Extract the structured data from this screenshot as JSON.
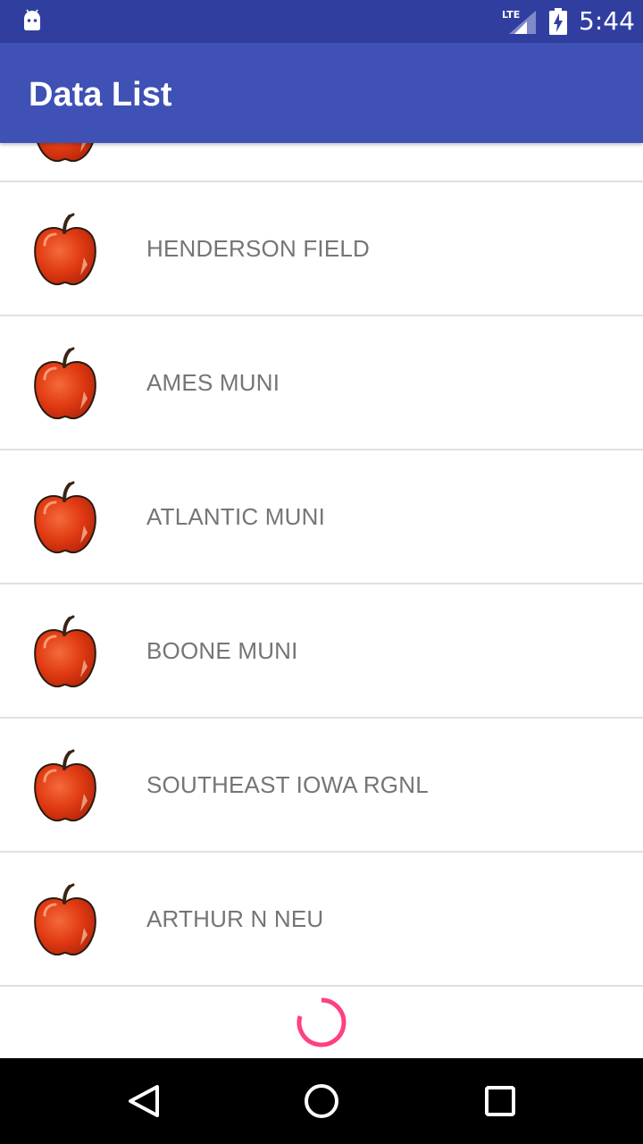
{
  "status_bar": {
    "time": "5:44",
    "network_label": "LTE",
    "icons": [
      "android-icon",
      "lte-signal-icon",
      "battery-charging-icon"
    ]
  },
  "app_bar": {
    "title": "Data List",
    "color": "#3f51b5"
  },
  "list": {
    "item_icon": "apple-icon",
    "items": [
      {
        "label": "HENDERSON FIELD"
      },
      {
        "label": "AMES MUNI"
      },
      {
        "label": "ATLANTIC MUNI"
      },
      {
        "label": "BOONE MUNI"
      },
      {
        "label": "SOUTHEAST IOWA RGNL"
      },
      {
        "label": "ARTHUR N NEU"
      }
    ]
  },
  "loading": {
    "icon": "loading-spinner",
    "accent_color": "#ff4081"
  },
  "nav_bar": {
    "buttons": [
      "back-button",
      "home-button",
      "recents-button"
    ]
  }
}
